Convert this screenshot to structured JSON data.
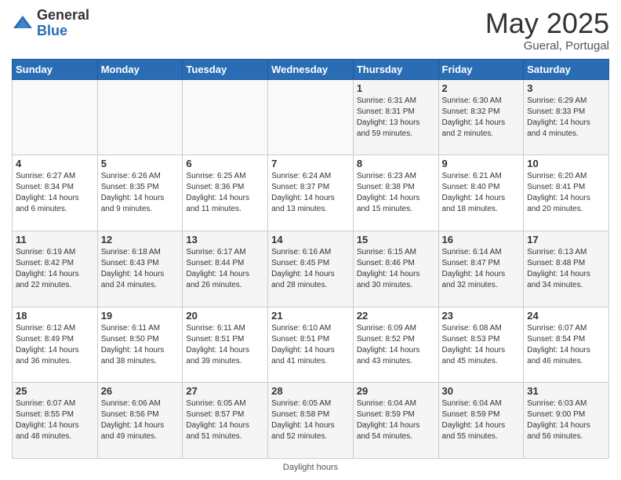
{
  "logo": {
    "general": "General",
    "blue": "Blue"
  },
  "title": "May 2025",
  "location": "Gueral, Portugal",
  "days_header": [
    "Sunday",
    "Monday",
    "Tuesday",
    "Wednesday",
    "Thursday",
    "Friday",
    "Saturday"
  ],
  "footer": "Daylight hours",
  "weeks": [
    [
      {
        "day": "",
        "info": ""
      },
      {
        "day": "",
        "info": ""
      },
      {
        "day": "",
        "info": ""
      },
      {
        "day": "",
        "info": ""
      },
      {
        "day": "1",
        "info": "Sunrise: 6:31 AM\nSunset: 8:31 PM\nDaylight: 13 hours\nand 59 minutes."
      },
      {
        "day": "2",
        "info": "Sunrise: 6:30 AM\nSunset: 8:32 PM\nDaylight: 14 hours\nand 2 minutes."
      },
      {
        "day": "3",
        "info": "Sunrise: 6:29 AM\nSunset: 8:33 PM\nDaylight: 14 hours\nand 4 minutes."
      }
    ],
    [
      {
        "day": "4",
        "info": "Sunrise: 6:27 AM\nSunset: 8:34 PM\nDaylight: 14 hours\nand 6 minutes."
      },
      {
        "day": "5",
        "info": "Sunrise: 6:26 AM\nSunset: 8:35 PM\nDaylight: 14 hours\nand 9 minutes."
      },
      {
        "day": "6",
        "info": "Sunrise: 6:25 AM\nSunset: 8:36 PM\nDaylight: 14 hours\nand 11 minutes."
      },
      {
        "day": "7",
        "info": "Sunrise: 6:24 AM\nSunset: 8:37 PM\nDaylight: 14 hours\nand 13 minutes."
      },
      {
        "day": "8",
        "info": "Sunrise: 6:23 AM\nSunset: 8:38 PM\nDaylight: 14 hours\nand 15 minutes."
      },
      {
        "day": "9",
        "info": "Sunrise: 6:21 AM\nSunset: 8:40 PM\nDaylight: 14 hours\nand 18 minutes."
      },
      {
        "day": "10",
        "info": "Sunrise: 6:20 AM\nSunset: 8:41 PM\nDaylight: 14 hours\nand 20 minutes."
      }
    ],
    [
      {
        "day": "11",
        "info": "Sunrise: 6:19 AM\nSunset: 8:42 PM\nDaylight: 14 hours\nand 22 minutes."
      },
      {
        "day": "12",
        "info": "Sunrise: 6:18 AM\nSunset: 8:43 PM\nDaylight: 14 hours\nand 24 minutes."
      },
      {
        "day": "13",
        "info": "Sunrise: 6:17 AM\nSunset: 8:44 PM\nDaylight: 14 hours\nand 26 minutes."
      },
      {
        "day": "14",
        "info": "Sunrise: 6:16 AM\nSunset: 8:45 PM\nDaylight: 14 hours\nand 28 minutes."
      },
      {
        "day": "15",
        "info": "Sunrise: 6:15 AM\nSunset: 8:46 PM\nDaylight: 14 hours\nand 30 minutes."
      },
      {
        "day": "16",
        "info": "Sunrise: 6:14 AM\nSunset: 8:47 PM\nDaylight: 14 hours\nand 32 minutes."
      },
      {
        "day": "17",
        "info": "Sunrise: 6:13 AM\nSunset: 8:48 PM\nDaylight: 14 hours\nand 34 minutes."
      }
    ],
    [
      {
        "day": "18",
        "info": "Sunrise: 6:12 AM\nSunset: 8:49 PM\nDaylight: 14 hours\nand 36 minutes."
      },
      {
        "day": "19",
        "info": "Sunrise: 6:11 AM\nSunset: 8:50 PM\nDaylight: 14 hours\nand 38 minutes."
      },
      {
        "day": "20",
        "info": "Sunrise: 6:11 AM\nSunset: 8:51 PM\nDaylight: 14 hours\nand 39 minutes."
      },
      {
        "day": "21",
        "info": "Sunrise: 6:10 AM\nSunset: 8:51 PM\nDaylight: 14 hours\nand 41 minutes."
      },
      {
        "day": "22",
        "info": "Sunrise: 6:09 AM\nSunset: 8:52 PM\nDaylight: 14 hours\nand 43 minutes."
      },
      {
        "day": "23",
        "info": "Sunrise: 6:08 AM\nSunset: 8:53 PM\nDaylight: 14 hours\nand 45 minutes."
      },
      {
        "day": "24",
        "info": "Sunrise: 6:07 AM\nSunset: 8:54 PM\nDaylight: 14 hours\nand 46 minutes."
      }
    ],
    [
      {
        "day": "25",
        "info": "Sunrise: 6:07 AM\nSunset: 8:55 PM\nDaylight: 14 hours\nand 48 minutes."
      },
      {
        "day": "26",
        "info": "Sunrise: 6:06 AM\nSunset: 8:56 PM\nDaylight: 14 hours\nand 49 minutes."
      },
      {
        "day": "27",
        "info": "Sunrise: 6:05 AM\nSunset: 8:57 PM\nDaylight: 14 hours\nand 51 minutes."
      },
      {
        "day": "28",
        "info": "Sunrise: 6:05 AM\nSunset: 8:58 PM\nDaylight: 14 hours\nand 52 minutes."
      },
      {
        "day": "29",
        "info": "Sunrise: 6:04 AM\nSunset: 8:59 PM\nDaylight: 14 hours\nand 54 minutes."
      },
      {
        "day": "30",
        "info": "Sunrise: 6:04 AM\nSunset: 8:59 PM\nDaylight: 14 hours\nand 55 minutes."
      },
      {
        "day": "31",
        "info": "Sunrise: 6:03 AM\nSunset: 9:00 PM\nDaylight: 14 hours\nand 56 minutes."
      }
    ]
  ]
}
